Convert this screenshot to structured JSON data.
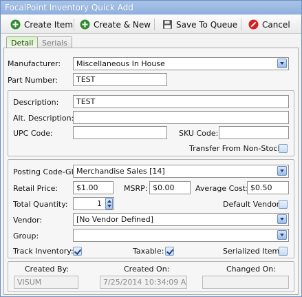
{
  "window": {
    "title": "FocalPoint Inventory Quick Add"
  },
  "toolbar": {
    "create_item": "Create Item",
    "create_new": "Create & New",
    "save_queue": "Save To Queue",
    "cancel": "Cancel"
  },
  "tabs": {
    "detail": "Detail",
    "serials": "Serials"
  },
  "form": {
    "manufacturer_label": "Manufacturer:",
    "manufacturer_value": "Miscellaneous In House",
    "part_number_label": "Part Number:",
    "part_number_value": "TEST",
    "description_label": "Description:",
    "description_value": "TEST",
    "alt_description_label": "Alt. Description:",
    "alt_description_value": "",
    "upc_label": "UPC Code:",
    "upc_value": "",
    "sku_label": "SKU Code:",
    "sku_value": "",
    "transfer_label": "Transfer From Non-Stock:",
    "transfer_checked": false,
    "posting_label": "Posting Code-GL:",
    "posting_value": "Merchandise Sales [14]",
    "retail_label": "Retail Price:",
    "retail_value": "$1.00",
    "msrp_label": "MSRP:",
    "msrp_value": "$0.00",
    "avg_cost_label": "Average Cost:",
    "avg_cost_value": "$0.50",
    "qty_label": "Total Quantity:",
    "qty_value": "1",
    "default_vendor_label": "Default Vendor:",
    "default_vendor_checked": false,
    "vendor_label": "Vendor:",
    "vendor_value": "[No Vendor Defined]",
    "group_label": "Group:",
    "group_value": "",
    "track_label": "Track Inventory:",
    "track_checked": true,
    "taxable_label": "Taxable:",
    "taxable_checked": true,
    "serialized_label": "Serialized Item:",
    "serialized_checked": false
  },
  "footer": {
    "created_by_label": "Created By:",
    "created_by_value": "VISUM",
    "created_on_label": "Created On:",
    "created_on_value": "7/25/2014 10:34:09 AM",
    "changed_on_label": "Changed On:",
    "changed_on_value": ""
  },
  "colors": {
    "title_bar": "#9bb9e3",
    "accent": "#1b3f80",
    "cancel_red": "#d32020",
    "add_green": "#2e8b2e"
  }
}
